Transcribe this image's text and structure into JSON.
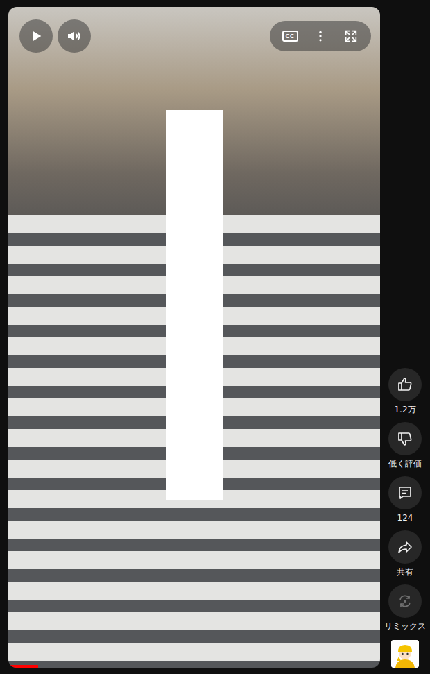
{
  "player": {
    "playing": false,
    "muted": false,
    "captions_label": "CC",
    "progress": {
      "level": 0.08
    }
  },
  "actions": [
    {
      "kind": "like",
      "label": "1.2万",
      "disabled": false
    },
    {
      "kind": "dislike",
      "label": "低く評価",
      "disabled": false
    },
    {
      "kind": "comments",
      "label": "124",
      "disabled": false
    },
    {
      "kind": "share",
      "label": "共有",
      "disabled": false
    },
    {
      "kind": "remix",
      "label": "リミックス",
      "disabled": true
    }
  ]
}
